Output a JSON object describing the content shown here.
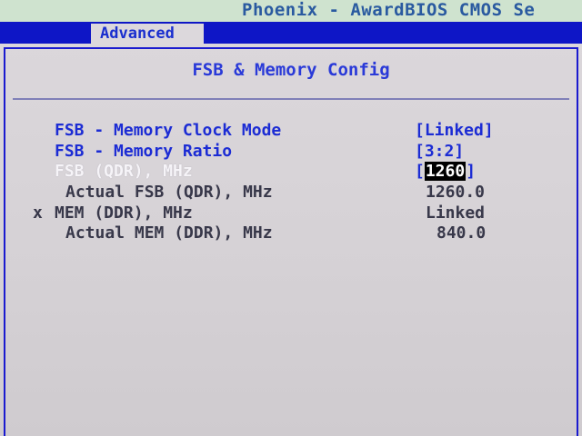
{
  "app": {
    "title": "Phoenix - AwardBIOS CMOS Se"
  },
  "tabs": [
    {
      "label": "Advanced",
      "active": true
    }
  ],
  "section": {
    "title": "FSB & Memory Config"
  },
  "settings": [
    {
      "label": "FSB - Memory Clock Mode",
      "value": "[Linked]",
      "editable": true,
      "highlighted": false
    },
    {
      "label": "FSB - Memory Ratio",
      "value": "[3:2]",
      "editable": true,
      "highlighted": false
    },
    {
      "label": "FSB (QDR), MHz",
      "value_open": "[",
      "value_selected": "1260",
      "value_close": "]",
      "editable": true,
      "highlighted": true
    },
    {
      "label": "Actual FSB (QDR), MHz",
      "value": "1260.0",
      "editable": false
    },
    {
      "marker": "x",
      "label": "MEM (DDR), MHz",
      "value": "Linked",
      "editable": false,
      "disabled": true
    },
    {
      "label": "Actual MEM (DDR), MHz",
      "value": "840.0",
      "editable": false
    }
  ],
  "colors": {
    "bar_blue": "#0e16c6",
    "option_blue": "#1c2cd4",
    "background": "#d8d4d8",
    "highlight_text": "#f6f4f8",
    "selection_bg": "#000000"
  }
}
